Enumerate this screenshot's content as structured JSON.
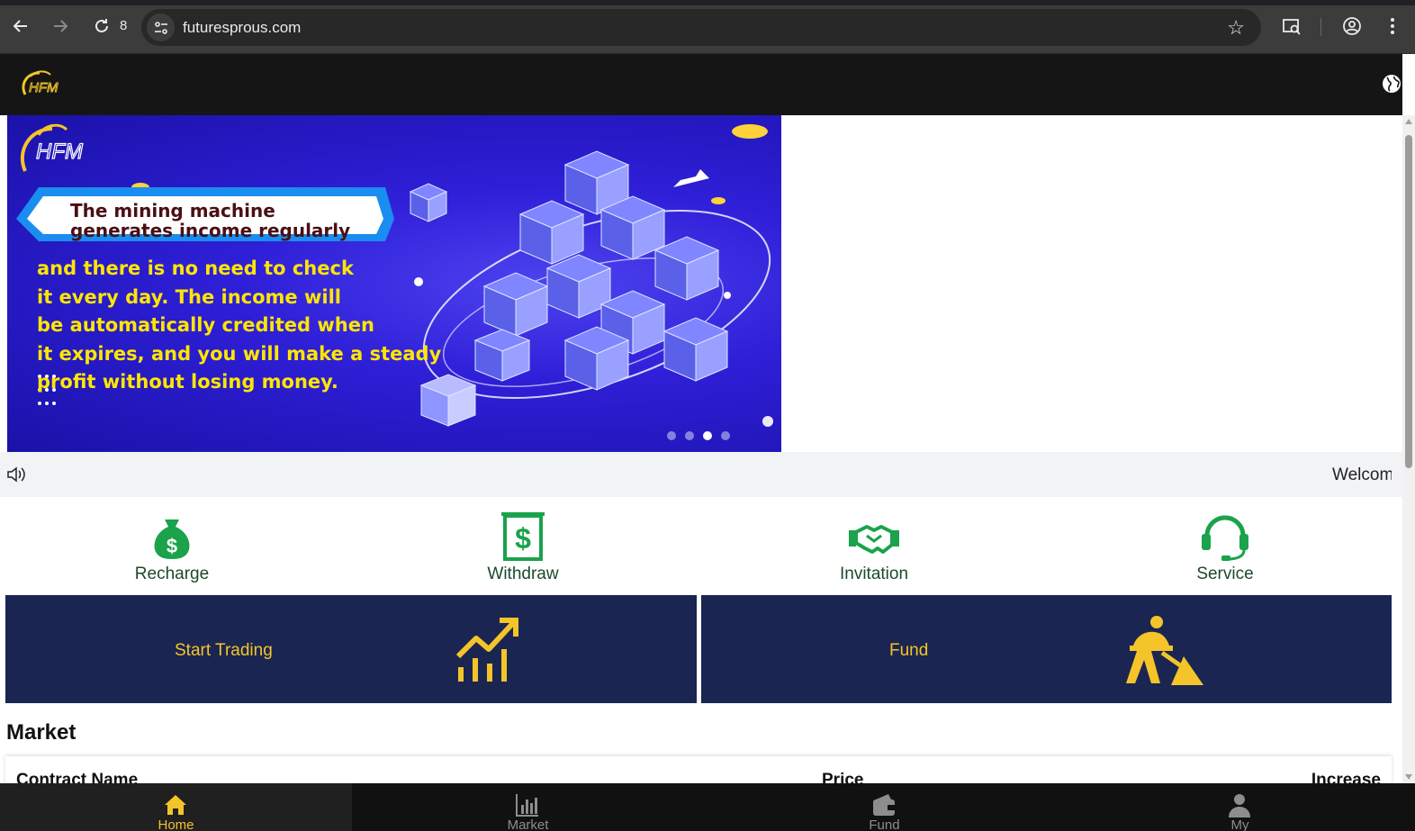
{
  "browser": {
    "tab_count": "8",
    "url": "futuresprous.com"
  },
  "header": {
    "logo_text": "HFM"
  },
  "banner": {
    "logo_text": "HFM",
    "ribbon_line1": "The mining machine",
    "ribbon_line2": "generates income regularly",
    "body_lines": [
      "and there is no need to check",
      "it every day. The income will",
      "be automatically credited when",
      "it expires, and you will make a steady",
      "profit without losing money."
    ],
    "active_slide": 3,
    "slide_count": 4
  },
  "notice": {
    "text": "Welcome"
  },
  "quick_actions": [
    {
      "label": "Recharge",
      "icon": "money-bag-icon"
    },
    {
      "label": "Withdraw",
      "icon": "dollar-bill-icon"
    },
    {
      "label": "Invitation",
      "icon": "handshake-icon"
    },
    {
      "label": "Service",
      "icon": "headset-icon"
    }
  ],
  "tiles": {
    "trading_label": "Start Trading",
    "fund_label": "Fund"
  },
  "market": {
    "title": "Market",
    "columns": [
      "Contract Name",
      "Price",
      "Increase"
    ]
  },
  "bottom_nav": [
    {
      "label": "Home",
      "icon": "home-icon"
    },
    {
      "label": "Market",
      "icon": "bar-chart-icon"
    },
    {
      "label": "Fund",
      "icon": "wallet-icon"
    },
    {
      "label": "My",
      "icon": "user-icon"
    }
  ],
  "colors": {
    "accent_gold": "#f4c42a",
    "tile_navy": "#1a2551",
    "action_green": "#1aa34a",
    "header_dark": "#151515"
  }
}
